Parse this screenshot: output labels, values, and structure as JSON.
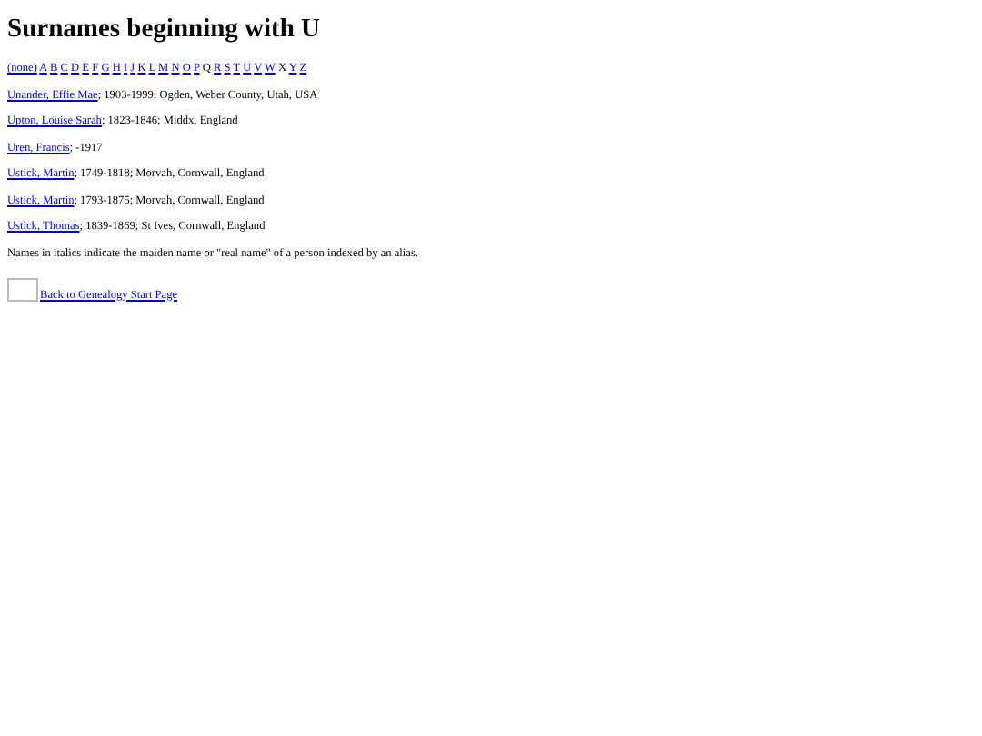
{
  "title": "Surnames beginning with U",
  "letters": [
    {
      "text": "(none)",
      "link": true
    },
    {
      "text": "A",
      "link": true
    },
    {
      "text": "B",
      "link": true
    },
    {
      "text": "C",
      "link": true
    },
    {
      "text": "D",
      "link": true
    },
    {
      "text": "E",
      "link": true
    },
    {
      "text": "F",
      "link": true
    },
    {
      "text": "G",
      "link": true
    },
    {
      "text": "H",
      "link": true
    },
    {
      "text": "I",
      "link": true
    },
    {
      "text": "J",
      "link": true
    },
    {
      "text": "K",
      "link": true
    },
    {
      "text": "L",
      "link": true
    },
    {
      "text": "M",
      "link": true
    },
    {
      "text": "N",
      "link": true
    },
    {
      "text": "O",
      "link": true
    },
    {
      "text": "P",
      "link": true
    },
    {
      "text": "Q",
      "link": false
    },
    {
      "text": "R",
      "link": true
    },
    {
      "text": "S",
      "link": true
    },
    {
      "text": "T",
      "link": true
    },
    {
      "text": "U",
      "link": true
    },
    {
      "text": "V",
      "link": true
    },
    {
      "text": "W",
      "link": true
    },
    {
      "text": "X",
      "link": false
    },
    {
      "text": "Y",
      "link": true
    },
    {
      "text": "Z",
      "link": true
    }
  ],
  "entries": [
    {
      "name": "Unander, Effie Mae",
      "details": "; 1903-1999; Ogden, Weber County, Utah, USA"
    },
    {
      "name": "Upton, Louise Sarah",
      "details": "; 1823-1846; Middx, England"
    },
    {
      "name": "Uren, Francis",
      "details": "; -1917"
    },
    {
      "name": "Ustick, Martin",
      "details": "; 1749-1818; Morvah, Cornwall, England"
    },
    {
      "name": "Ustick, Martin",
      "details": "; 1793-1875; Morvah, Cornwall, England"
    },
    {
      "name": "Ustick, Thomas",
      "details": "; 1839-1869; St Ives, Cornwall, England"
    }
  ],
  "note": "Names in italics indicate the maiden name or \"real name\" of a person indexed by an alias.",
  "back_link": "Back to Genealogy Start Page"
}
